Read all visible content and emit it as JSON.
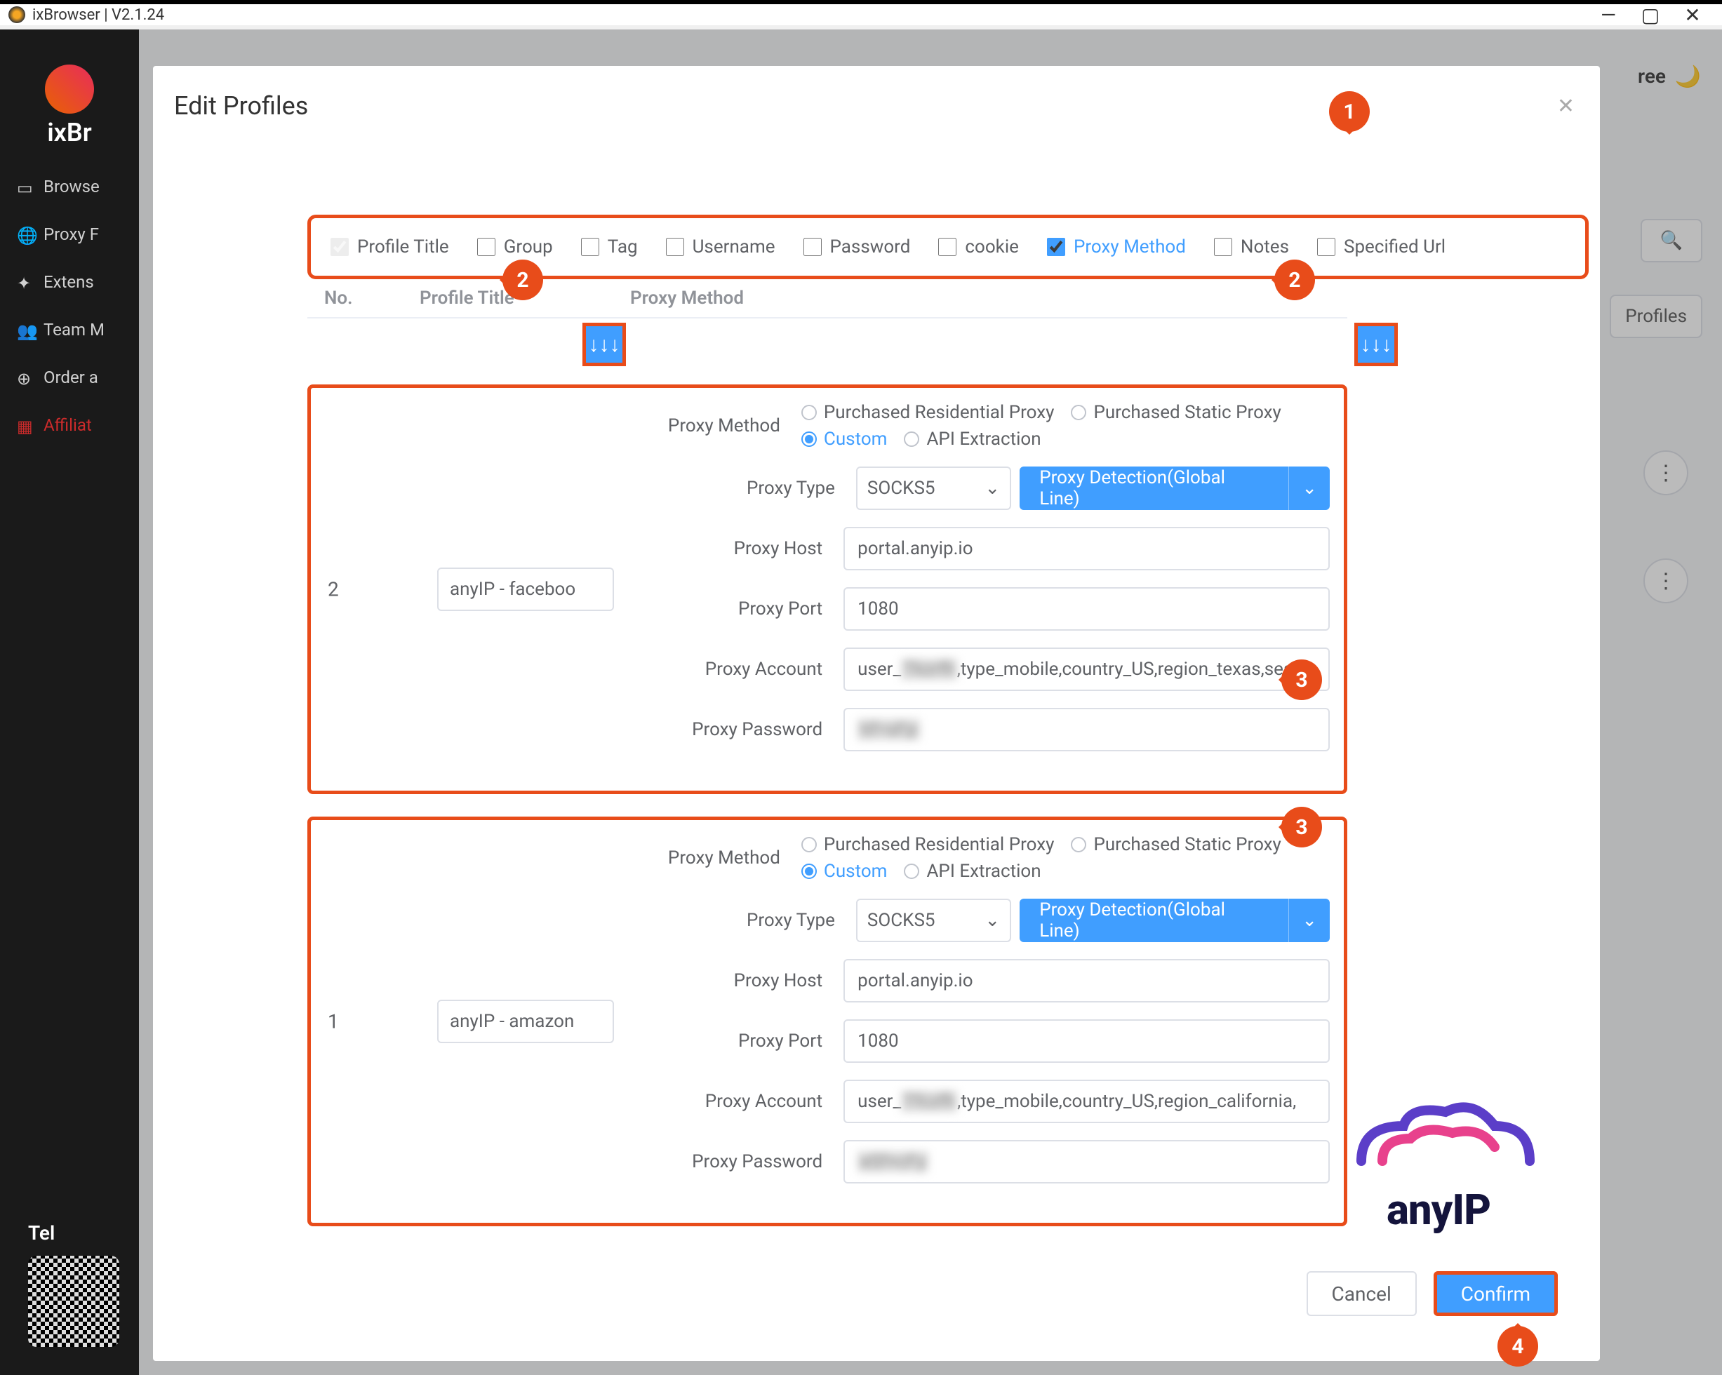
{
  "titlebar": {
    "title": "ixBrowser | V2.1.24"
  },
  "logo_text": "ixBr",
  "sidebar": {
    "items": [
      {
        "label": "Browse"
      },
      {
        "label": "Proxy F"
      },
      {
        "label": "Extens"
      },
      {
        "label": "Team M"
      },
      {
        "label": "Order a"
      },
      {
        "label": "Affiliat"
      }
    ],
    "tel_label": "Tel"
  },
  "top": {
    "free_label": "ree",
    "profiles_btn": "Profiles"
  },
  "modal": {
    "title": "Edit Profiles",
    "columns": {
      "profile_title": "Profile Title",
      "group": "Group",
      "tag": "Tag",
      "username": "Username",
      "password": "Password",
      "cookie": "cookie",
      "proxy_method": "Proxy Method",
      "notes": "Notes",
      "specified_url": "Specified Url"
    },
    "headers": {
      "no": "No.",
      "title": "Profile Title",
      "method": "Proxy Method"
    },
    "labels": {
      "proxy_method": "Proxy Method",
      "proxy_type": "Proxy Type",
      "proxy_host": "Proxy Host",
      "proxy_port": "Proxy Port",
      "proxy_account": "Proxy Account",
      "proxy_password": "Proxy Password"
    },
    "radios": {
      "purchased_residential": "Purchased Residential Proxy",
      "purchased_static": "Purchased Static Proxy",
      "custom": "Custom",
      "api_extraction": "API Extraction"
    },
    "proxy_type_value": "SOCKS5",
    "detect_btn": "Proxy Detection(Global Line)",
    "rows": [
      {
        "no": "2",
        "title": "anyIP - faceboo",
        "host": "portal.anyip.io",
        "port": "1080",
        "account_prefix": "user_",
        "account_mid": "Tkzrfli",
        "account_suffix": ",type_mobile,country_US,region_texas,ses",
        "password_mask": "tif=sFp"
      },
      {
        "no": "1",
        "title": "anyIP - amazon",
        "host": "portal.anyip.io",
        "port": "1080",
        "account_prefix": "user_",
        "account_mid": "Tfczfli",
        "account_suffix": ",type_mobile,country_US,region_california,",
        "password_mask": "eSf+cFy"
      }
    ],
    "cancel": "Cancel",
    "confirm": "Confirm"
  },
  "annotations": {
    "a1": "1",
    "a2": "2",
    "a3": "3",
    "a4": "4"
  },
  "anyip_text": "anyIP"
}
